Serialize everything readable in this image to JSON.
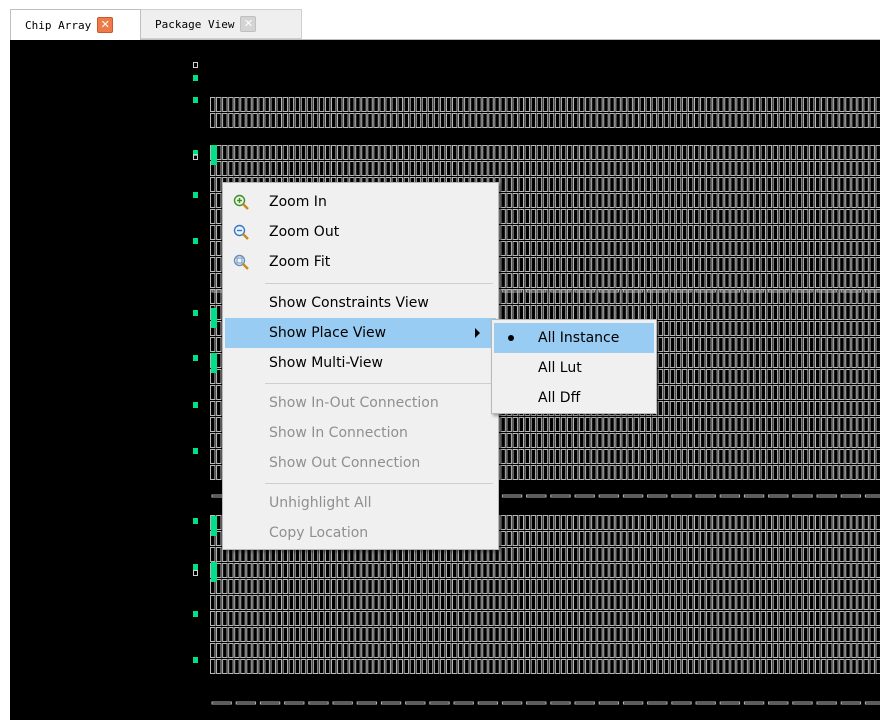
{
  "tabs": [
    {
      "label": "Chip Array",
      "active": true,
      "close_icon": "close-icon"
    },
    {
      "label": "Package View",
      "active": false,
      "close_icon": "close-icon"
    }
  ],
  "colors": {
    "canvas_bg": "#000000",
    "grid_cell": "#b8b8b8",
    "io_pad": "#00e08a",
    "menu_bg": "#f0f0f0",
    "menu_highlight": "#99ccf3",
    "disabled_text": "#8f8f8f",
    "tab_close_active": "#ee7a4a"
  },
  "context_menu": {
    "items": [
      {
        "label": "Zoom In",
        "icon": "zoom-in-icon",
        "enabled": true
      },
      {
        "label": "Zoom Out",
        "icon": "zoom-out-icon",
        "enabled": true
      },
      {
        "label": "Zoom Fit",
        "icon": "zoom-fit-icon",
        "enabled": true
      },
      {
        "label": "Show Constraints View",
        "enabled": true
      },
      {
        "label": "Show Place View",
        "enabled": true,
        "highlighted": true,
        "has_submenu": true
      },
      {
        "label": "Show Multi-View",
        "enabled": true
      },
      {
        "label": "Show In-Out Connection",
        "enabled": false
      },
      {
        "label": "Show In Connection",
        "enabled": false
      },
      {
        "label": "Show Out Connection",
        "enabled": false
      },
      {
        "label": "Unhighlight All",
        "enabled": false
      },
      {
        "label": "Copy Location",
        "enabled": false
      }
    ]
  },
  "place_view_submenu": {
    "items": [
      {
        "label": "All Instance",
        "selected": true,
        "highlighted": true
      },
      {
        "label": "All Lut",
        "selected": false
      },
      {
        "label": "All Dff",
        "selected": false
      }
    ]
  }
}
